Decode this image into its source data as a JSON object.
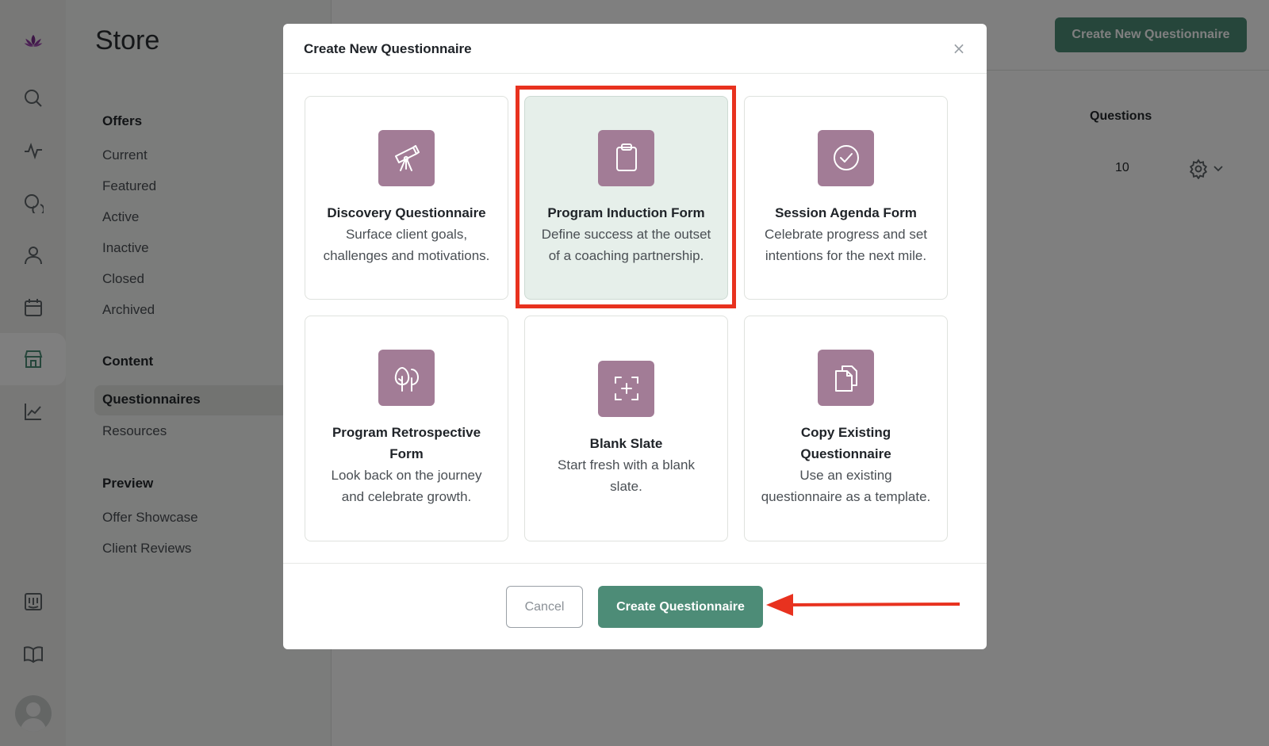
{
  "sidebar": {
    "icons": [
      "lotus-logo-icon",
      "search-icon",
      "activity-icon",
      "chat-icon",
      "user-icon",
      "calendar-icon",
      "store-icon",
      "chart-icon",
      "board-icon",
      "book-icon"
    ]
  },
  "store": {
    "title": "Store",
    "groups": [
      {
        "label": "Offers",
        "items": [
          "Current",
          "Featured",
          "Active",
          "Inactive",
          "Closed",
          "Archived"
        ]
      },
      {
        "label": "Content",
        "items": [
          "Questionnaires",
          "Resources"
        ]
      },
      {
        "label": "Preview",
        "items": [
          "Offer Showcase",
          "Client Reviews"
        ]
      }
    ],
    "active_item": "Questionnaires"
  },
  "main": {
    "create_button": "Create New Questionnaire",
    "column_header": "Questions",
    "row_count": "10"
  },
  "modal": {
    "title": "Create New Questionnaire",
    "close_label": "×",
    "cards": [
      {
        "title": "Discovery Questionnaire",
        "desc": "Surface client goals, challenges and motivations.",
        "icon": "telescope-icon"
      },
      {
        "title": "Program Induction Form",
        "desc": "Define success at the outset of a coaching partnership.",
        "icon": "clipboard-icon",
        "selected": true
      },
      {
        "title": "Session Agenda Form",
        "desc": "Celebrate progress and set intentions for the next mile.",
        "icon": "check-circle-icon"
      },
      {
        "title": "Program Retrospective Form",
        "desc": "Look back on the journey and celebrate growth.",
        "icon": "trees-icon"
      },
      {
        "title": "Blank Slate",
        "desc": "Start fresh with a blank slate.",
        "icon": "blank-slate-icon"
      },
      {
        "title": "Copy Existing Questionnaire",
        "desc": "Use an existing questionnaire as a template.",
        "icon": "copy-icon"
      }
    ],
    "cancel_label": "Cancel",
    "create_label": "Create Questionnaire"
  },
  "colors": {
    "accent": "#4d8c77",
    "icon_tile": "#a27c96",
    "selected_card": "#e6efea",
    "annotation": "#e8321f"
  }
}
